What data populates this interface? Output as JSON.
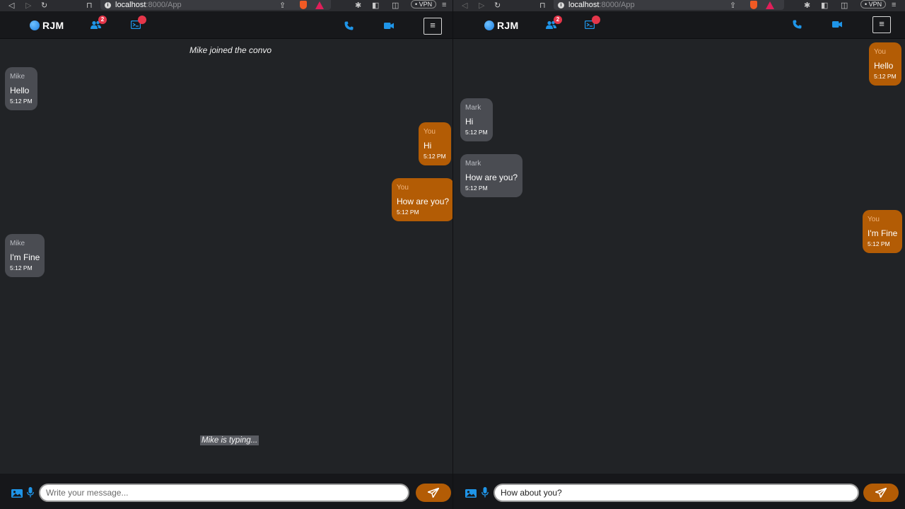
{
  "browser": {
    "url_host": "localhost",
    "url_path": ":8000/App",
    "vpn_label": "• VPN"
  },
  "app": {
    "brand": "RJM",
    "friends_badge": "2",
    "messages_badge": "",
    "menu_label": "≡"
  },
  "left": {
    "system_note": "Mike joined the convo",
    "messages": [
      {
        "sender": "Mike",
        "text": "Hello",
        "time": "5:12 PM",
        "direction": "in"
      },
      {
        "sender": "You",
        "text": "Hi",
        "time": "5:12 PM",
        "direction": "out"
      },
      {
        "sender": "You",
        "text": "How are you?",
        "time": "5:12 PM",
        "direction": "out"
      },
      {
        "sender": "Mike",
        "text": "I'm Fine",
        "time": "5:12 PM",
        "direction": "in"
      }
    ],
    "typing": "Mike is typing...",
    "composer": {
      "placeholder": "Write your message...",
      "value": ""
    }
  },
  "right": {
    "messages": [
      {
        "sender": "You",
        "text": "Hello",
        "time": "5:12 PM",
        "direction": "out"
      },
      {
        "sender": "Mark",
        "text": "Hi",
        "time": "5:12 PM",
        "direction": "in"
      },
      {
        "sender": "Mark",
        "text": "How are you?",
        "time": "5:12 PM",
        "direction": "in"
      },
      {
        "sender": "You",
        "text": "I'm Fine",
        "time": "5:12 PM",
        "direction": "out"
      }
    ],
    "composer": {
      "placeholder": "",
      "value": "How about you?"
    }
  },
  "colors": {
    "accent": "#b35c05",
    "incoming_bubble": "#4a4c52",
    "badge": "#e5364a",
    "icon_blue": "#1f95e8"
  }
}
